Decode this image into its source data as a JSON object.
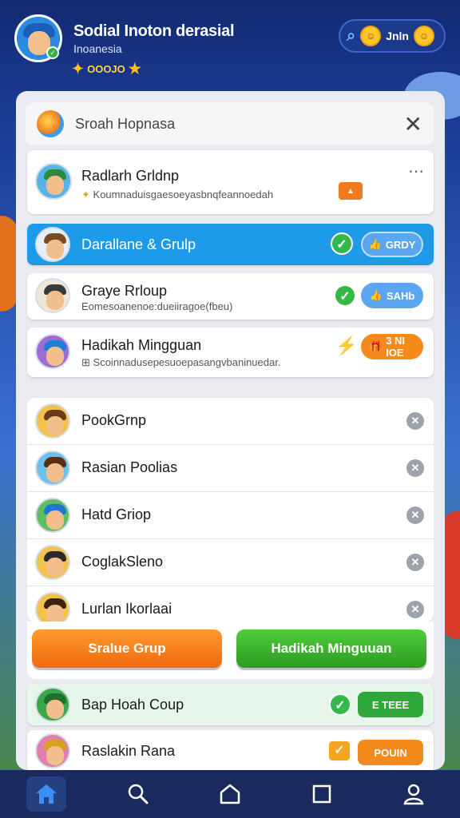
{
  "header": {
    "title": "Sodial Inoton derasial",
    "subtitle": "Inoanesia",
    "badge": "OOOJO",
    "coin_label": "Jnln"
  },
  "search": {
    "placeholder": "Sroah Hopnasa"
  },
  "featured_rows": [
    {
      "name": "Radlarh Grldnp",
      "desc": "Koumnaduisgaesoeyasbnqfeannoedah",
      "action": "▲",
      "action_color": "#f07b1f"
    },
    {
      "name": "Darallane & Grulp",
      "desc": "",
      "action": "GRDY",
      "action_color": "#5aa6f0"
    },
    {
      "name": "Grayе Rrloup",
      "desc": "Eomesoanenoe:dueiiragoe(fbeu)",
      "action": "SAHb",
      "action_color": "#5aa6f0"
    },
    {
      "name": "Hadikah Mingguan",
      "desc": "Scoinnadusepesuoepasangvbaninuedar.",
      "action": "3 NI IOE",
      "action_color": "#f58a1c"
    }
  ],
  "list_items": [
    {
      "name": "PookGrnp"
    },
    {
      "name": "Rasian Poolias"
    },
    {
      "name": "Hatd Griop"
    },
    {
      "name": "CoglakSleno"
    },
    {
      "name": "Lurlan Ikorlaai"
    }
  ],
  "cta": {
    "left_label": "Sralue Grup",
    "right_label": "Hadikah Minguuan"
  },
  "bottom_rows": [
    {
      "name": "Bap Hoah Coup",
      "action": "E TEEE",
      "action_color": "#2fa83a"
    },
    {
      "name": "Raslakin Rana",
      "action": "POUIN",
      "action_color": "#f58a1c"
    }
  ],
  "nav": {
    "home": "home-icon",
    "search": "search-icon",
    "groups": "home-outline-icon",
    "square": "square-icon",
    "profile": "user-icon"
  },
  "colors": {
    "highlight": "#1e9be8",
    "accent_orange": "#f06a0e",
    "accent_green": "#2b9c22",
    "nav_bg": "#1a2a5e"
  }
}
